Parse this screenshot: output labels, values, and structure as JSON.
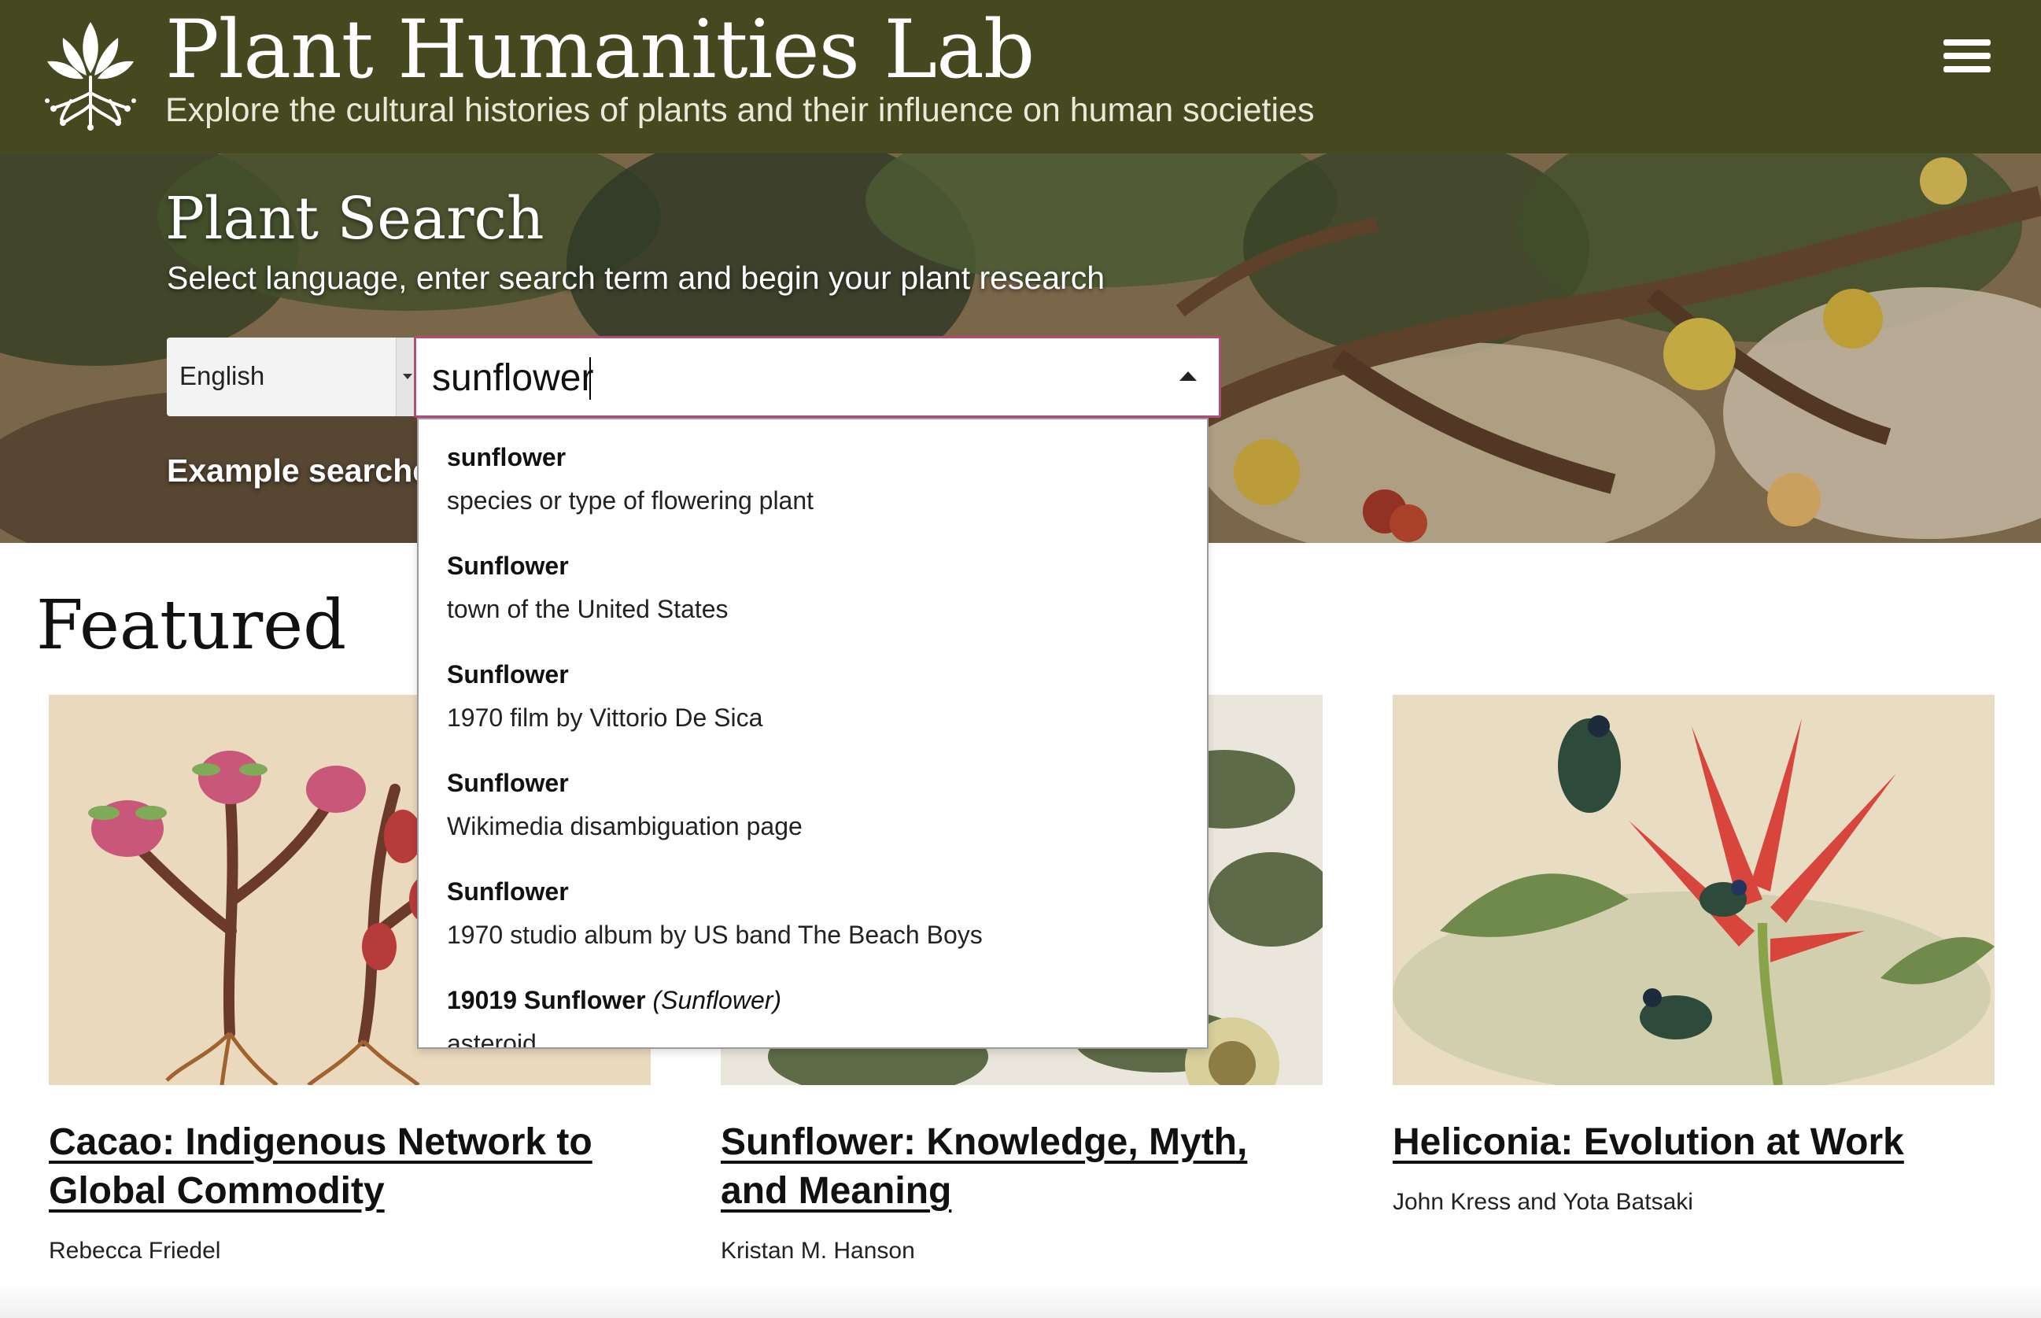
{
  "header": {
    "title": "Plant Humanities Lab",
    "tagline": "Explore the cultural histories of plants and their influence on human societies",
    "menu_icon": "hamburger-menu-icon",
    "logo_icon": "plant-roots-logo-icon"
  },
  "search": {
    "title": "Plant Search",
    "subtitle": "Select language, enter search term and begin your plant research",
    "language": "English",
    "query": "sunflower",
    "example_label": "Example searche",
    "accent_color": "#b24b78"
  },
  "suggestions": [
    {
      "label": "sunflower",
      "alias": "",
      "description": "species or type of flowering plant"
    },
    {
      "label": "Sunflower",
      "alias": "",
      "description": "town of the United States"
    },
    {
      "label": "Sunflower",
      "alias": "",
      "description": "1970 film by Vittorio De Sica"
    },
    {
      "label": "Sunflower",
      "alias": "",
      "description": "Wikimedia disambiguation page"
    },
    {
      "label": "Sunflower",
      "alias": "",
      "description": "1970 studio album by US band The Beach Boys"
    },
    {
      "label": "19019 Sunflower",
      "alias": "(Sunflower)",
      "description": "asteroid"
    }
  ],
  "featured": {
    "heading": "Featured",
    "cards": [
      {
        "title": "Cacao: Indigenous Network to Global Commodity",
        "author": "Rebecca Friedel"
      },
      {
        "title": "Sunflower: Knowledge, Myth, and Meaning",
        "author": "Kristan M. Hanson"
      },
      {
        "title": "Heliconia: Evolution at Work",
        "author": "John Kress and Yota Batsaki"
      }
    ]
  },
  "colors": {
    "header_bg": "#46491f",
    "focus_border": "#b24b78"
  }
}
